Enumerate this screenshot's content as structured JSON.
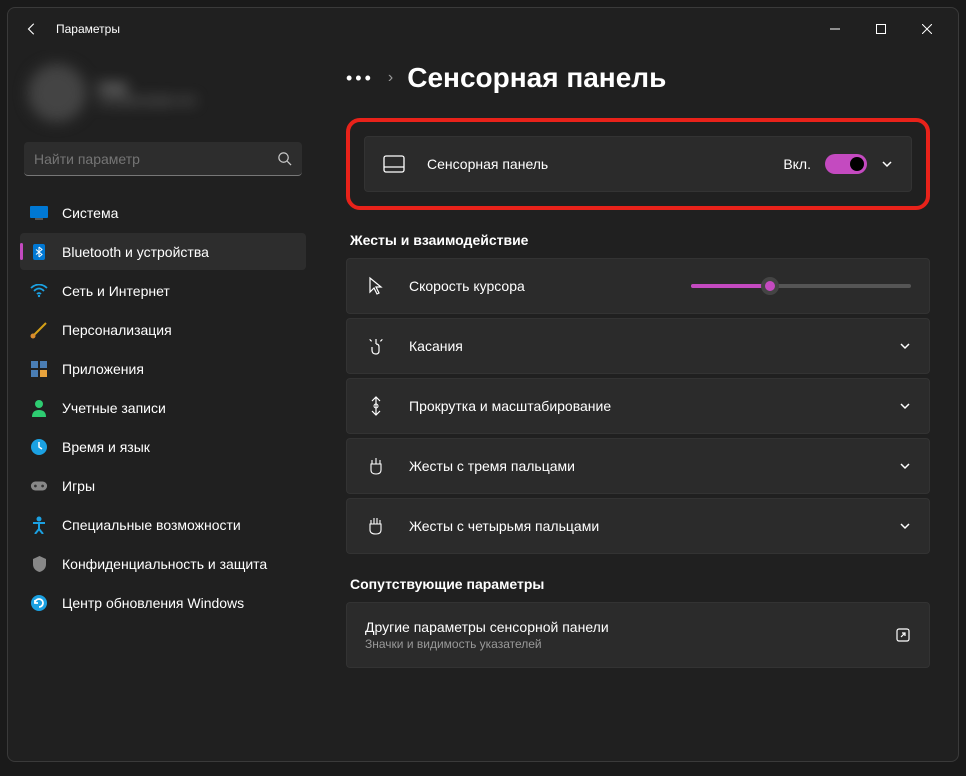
{
  "titlebar": {
    "title": "Параметры"
  },
  "profile": {
    "name": "User",
    "email": "user@example.com"
  },
  "search": {
    "placeholder": "Найти параметр"
  },
  "sidebar": {
    "items": [
      {
        "label": "Система"
      },
      {
        "label": "Bluetooth и устройства"
      },
      {
        "label": "Сеть и Интернет"
      },
      {
        "label": "Персонализация"
      },
      {
        "label": "Приложения"
      },
      {
        "label": "Учетные записи"
      },
      {
        "label": "Время и язык"
      },
      {
        "label": "Игры"
      },
      {
        "label": "Специальные возможности"
      },
      {
        "label": "Конфиденциальность и защита"
      },
      {
        "label": "Центр обновления Windows"
      }
    ]
  },
  "breadcrumb": {
    "dots": "•••",
    "sep": "›",
    "title": "Сенсорная панель"
  },
  "touchpad": {
    "label": "Сенсорная панель",
    "state": "Вкл."
  },
  "sections": {
    "gestures": "Жесты и взаимодействие",
    "related": "Сопутствующие параметры"
  },
  "cards": {
    "cursor": "Скорость курсора",
    "touches": "Касания",
    "scroll": "Прокрутка и масштабирование",
    "three": "Жесты с тремя пальцами",
    "four": "Жесты с четырьмя пальцами"
  },
  "related": {
    "other_title": "Другие параметры сенсорной панели",
    "other_sub": "Значки и видимость указателей"
  },
  "slider": {
    "value": 36
  }
}
